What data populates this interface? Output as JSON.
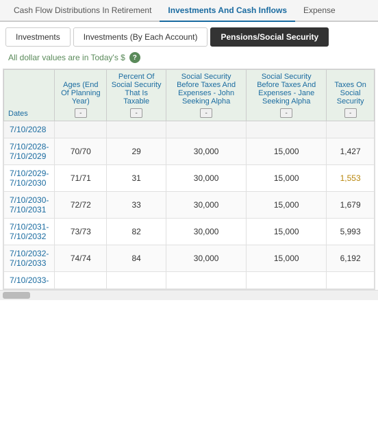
{
  "topTabs": [
    {
      "id": "cash-flow",
      "label": "Cash Flow Distributions In Retirement",
      "active": false
    },
    {
      "id": "investments",
      "label": "Investments And Cash Inflows",
      "active": true
    },
    {
      "id": "expenses",
      "label": "Expense",
      "active": false
    }
  ],
  "secondTabs": [
    {
      "id": "investments-tab",
      "label": "Investments",
      "active": false
    },
    {
      "id": "investments-by-account",
      "label": "Investments (By Each Account)",
      "active": false
    },
    {
      "id": "pensions",
      "label": "Pensions/Social Security",
      "active": true
    }
  ],
  "infoBar": {
    "text": "All dollar values are in Today's $",
    "helpLabel": "?"
  },
  "table": {
    "columns": [
      {
        "id": "dates",
        "label": "Dates",
        "hasBtn": false
      },
      {
        "id": "ages",
        "label": "Ages (End Of Planning Year)",
        "hasBtn": true
      },
      {
        "id": "percent",
        "label": "Percent Of Social Security That Is Taxable",
        "hasBtn": true,
        "hasArrow": true
      },
      {
        "id": "ss-john",
        "label": "Social Security Before Taxes And Expenses - John Seeking Alpha",
        "hasBtn": true
      },
      {
        "id": "ss-jane",
        "label": "Social Security Before Taxes And Expenses - Jane Seeking Alpha",
        "hasBtn": true
      },
      {
        "id": "taxes",
        "label": "Taxes On Social Security",
        "hasBtn": true
      }
    ],
    "rows": [
      {
        "dates": "7/10/2028",
        "ages": "",
        "percent": "",
        "ssJohn": "",
        "ssJane": "",
        "taxes": "",
        "isEmpty": true
      },
      {
        "dates": "7/10/2028-\n7/10/2029",
        "ages": "70/70",
        "percent": "29",
        "ssJohn": "30,000",
        "ssJane": "15,000",
        "taxes": "1,427",
        "taxesYellow": false
      },
      {
        "dates": "7/10/2029-\n7/10/2030",
        "ages": "71/71",
        "percent": "31",
        "ssJohn": "30,000",
        "ssJane": "15,000",
        "taxes": "1,553",
        "taxesYellow": true
      },
      {
        "dates": "7/10/2030-\n7/10/2031",
        "ages": "72/72",
        "percent": "33",
        "ssJohn": "30,000",
        "ssJane": "15,000",
        "taxes": "1,679",
        "taxesYellow": false
      },
      {
        "dates": "7/10/2031-\n7/10/2032",
        "ages": "73/73",
        "percent": "82",
        "ssJohn": "30,000",
        "ssJane": "15,000",
        "taxes": "5,993",
        "taxesYellow": false
      },
      {
        "dates": "7/10/2032-\n7/10/2033",
        "ages": "74/74",
        "percent": "84",
        "ssJohn": "30,000",
        "ssJane": "15,000",
        "taxes": "6,192",
        "taxesYellow": false
      },
      {
        "dates": "7/10/2033-",
        "ages": "",
        "percent": "",
        "ssJohn": "",
        "ssJane": "",
        "taxes": "",
        "isEmpty": false
      }
    ]
  }
}
